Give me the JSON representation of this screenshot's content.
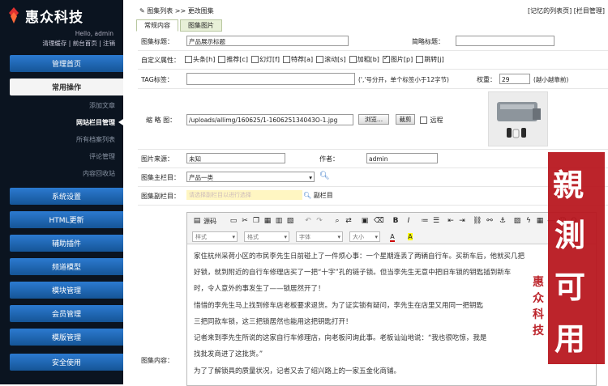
{
  "app": {
    "logo_text": "惠众科技",
    "hello": "Hello, admin",
    "links": "清理缓存 | 前台首页 | 注销",
    "accent": "#1a5fa8"
  },
  "nav": {
    "home": "管理首页",
    "ops": "常用操作",
    "ops_items": [
      "添加文章",
      "网站栏目管理",
      "所有档案列表",
      "评论管理",
      "内容回收站"
    ],
    "sections": [
      "系统设置",
      "HTML更新",
      "辅助插件",
      "频道模型",
      "模块管理",
      "会员管理",
      "模版管理",
      "安全使用"
    ]
  },
  "crumb": {
    "a": "图集列表",
    "sep": ">>",
    "b": "更改图集"
  },
  "toplinks": {
    "a": "[记忆的列表页]",
    "b": "[栏目管理]"
  },
  "tabs": [
    "常规内容",
    "图集图片"
  ],
  "form": {
    "title_label": "图集标题：",
    "title_value": "产品展示标题",
    "short_label": "简略标题：",
    "short_value": "",
    "attr_label": "自定义属性：",
    "attrs": [
      {
        "t": "头条[h]",
        "on": false
      },
      {
        "t": "推荐[c]",
        "on": false
      },
      {
        "t": "幻灯[f]",
        "on": false
      },
      {
        "t": "特荐[a]",
        "on": false
      },
      {
        "t": "滚动[s]",
        "on": false
      },
      {
        "t": "加粗[b]",
        "on": false
      },
      {
        "t": "图片[p]",
        "on": true
      },
      {
        "t": "跳转[j]",
        "on": false
      }
    ],
    "tag_label": "TAG标签：",
    "tag_value": "",
    "tag_hint": "(','号分开，单个标签小于12字节)",
    "weight_label": "权重：",
    "weight_value": "29",
    "weight_hint": "(越小越靠前)",
    "thumb_label": "缩 略 图：",
    "thumb_value": "/uploads/allimg/160625/1-160625134043O-1.jpg",
    "browse": "浏览...",
    "cut": "裁剪",
    "remote": "远程",
    "source_label": "图片来源：",
    "source_value": "未知",
    "author_label": "作者：",
    "author_value": "admin",
    "main_cat_label": "图集主栏目：",
    "main_cat_value": "产品一类",
    "sub_cat_label": "图集副栏目：",
    "sub_cat_hint": "请选择副栏目以进行选择",
    "sub_cat_btn": "副栏目",
    "content_label": "图集内容："
  },
  "editor": {
    "source_btn": "源码",
    "combos": [
      "样式",
      "格式",
      "字体",
      "大小"
    ],
    "paragraphs": [
      "家住杭州采荷小区的市民李先生日前碰上了一件烦心事：一个星期连丢了两辆自行车。买新车后，他就买几把",
      "好锁，就到附近的自行车修理店买了一把“十字”孔的链子锁。但当李先生无意中把旧车锁的钥匙插到新车",
      "时，令人意外的事发生了——锁居然开了！",
      "惜惜的李先生马上找到修车店老板要求退货。为了证实锁有疑问，李先生在店里又用同一把钥匙",
      "三把同款车锁，这三把锁居然也能用这把钥匙打开！",
      "记者来到李先生所说的这家自行车修理店，向老板问询此事。老板讪讪地说：“我也很吃惊，我是",
      "找批发商进了这批货。”",
      "为了了解锁具的质量状况，记者又去了绍兴路上的一家五金化商铺。"
    ]
  },
  "stamp": {
    "big": [
      "親",
      "測",
      "可",
      "用"
    ],
    "small": [
      "惠",
      "众",
      "科",
      "技"
    ],
    "color": "#b8141c"
  }
}
